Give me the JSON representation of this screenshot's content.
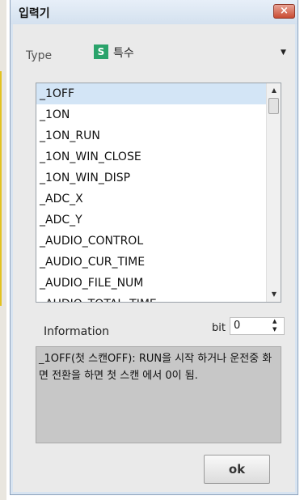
{
  "window": {
    "title": "입력기",
    "close_label": "×"
  },
  "type": {
    "label": "Type",
    "badge": "S",
    "value": "특수"
  },
  "list": {
    "items": [
      "_1OFF",
      "_1ON",
      "_1ON_RUN",
      "_1ON_WIN_CLOSE",
      "_1ON_WIN_DISP",
      "_ADC_X",
      "_ADC_Y",
      "_AUDIO_CONTROL",
      "_AUDIO_CUR_TIME",
      "_AUDIO_FILE_NUM",
      "_AUDIO_TOTAL_TIME"
    ],
    "selected_index": 0
  },
  "info": {
    "label": "Information",
    "bit_label": "bit",
    "bit_value": "0",
    "text": "_1OFF(첫 스캔OFF): RUN을 시작 하거나 운전중 화면 전환을 하면 첫 스캔 에서 0이 됨."
  },
  "ok_label": "ok",
  "colors": {
    "titlebar": "#d4e1ef",
    "close": "#c94b32",
    "badge": "#2aa36b",
    "selected": "#d3e5f6",
    "info_bg": "#c7c7c7"
  },
  "icons": {
    "close": "close-icon",
    "dropdown": "chevron-down-icon",
    "scroll_up": "arrow-up-icon",
    "scroll_down": "arrow-down-icon"
  }
}
